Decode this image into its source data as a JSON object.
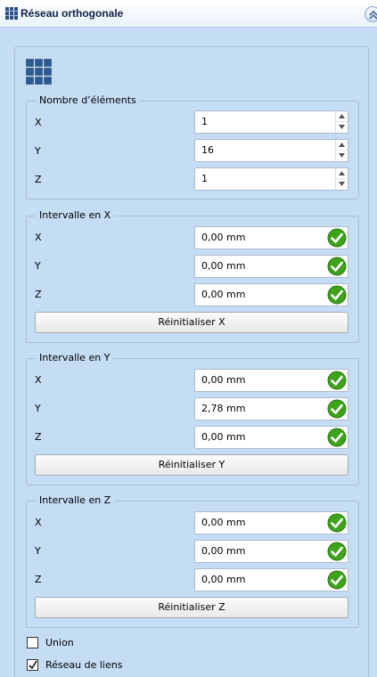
{
  "title": "Réseau orthogonale",
  "icons": {
    "title": "grid-array-icon",
    "collapse": "double-chevron-up-icon",
    "array": "orthogonal-array-icon",
    "valid": "green-check-icon"
  },
  "colors": {
    "background": "#c4dcf4",
    "accent": "#2b5a94",
    "valid": "#3ea21b"
  },
  "nombre": {
    "title": "Nombre d’éléments",
    "rows": [
      {
        "label": "X",
        "value": "1"
      },
      {
        "label": "Y",
        "value": "16"
      },
      {
        "label": "Z",
        "value": "1"
      }
    ]
  },
  "intervalle_x": {
    "title": "Intervalle en X",
    "rows": [
      {
        "label": "X",
        "value": "0,00 mm"
      },
      {
        "label": "Y",
        "value": "0,00 mm"
      },
      {
        "label": "Z",
        "value": "0,00 mm"
      }
    ],
    "reset_label": "Réinitialiser X"
  },
  "intervalle_y": {
    "title": "Intervalle en Y",
    "rows": [
      {
        "label": "X",
        "value": "0,00 mm"
      },
      {
        "label": "Y",
        "value": "2,78 mm"
      },
      {
        "label": "Z",
        "value": "0,00 mm"
      }
    ],
    "reset_label": "Réinitialiser Y"
  },
  "intervalle_z": {
    "title": "Intervalle en Z",
    "rows": [
      {
        "label": "X",
        "value": "0,00 mm"
      },
      {
        "label": "Y",
        "value": "0,00 mm"
      },
      {
        "label": "Z",
        "value": "0,00 mm"
      }
    ],
    "reset_label": "Réinitialiser Z"
  },
  "options": {
    "union": {
      "label": "Union",
      "checked": false
    },
    "link_array": {
      "label": "Réseau de liens",
      "checked": true
    }
  }
}
